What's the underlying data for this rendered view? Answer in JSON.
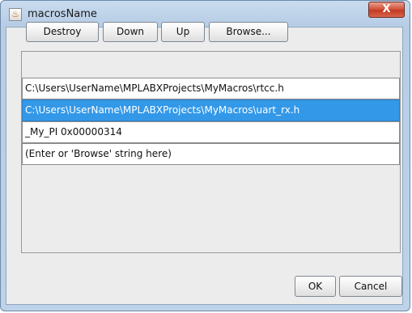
{
  "window": {
    "title": "macrosName",
    "app_icon_glyph": "♨",
    "close_glyph": "X"
  },
  "toolbar": {
    "destroy_label": "Destroy",
    "down_label": "Down",
    "up_label": "Up",
    "browse_label": "Browse..."
  },
  "list": {
    "items": [
      {
        "text": "C:\\Users\\UserName\\MPLABXProjects\\MyMacros\\rtcc.h",
        "selected": false
      },
      {
        "text": "C:\\Users\\UserName\\MPLABXProjects\\MyMacros\\uart_rx.h",
        "selected": true
      },
      {
        "text": "_My_PI 0x00000314",
        "selected": false
      },
      {
        "text": "(Enter or 'Browse' string here)",
        "selected": false
      }
    ]
  },
  "footer": {
    "ok_label": "OK",
    "cancel_label": "Cancel"
  },
  "colors": {
    "selection": "#3398e8",
    "title_bar": "#c9dbee",
    "close_button": "#c23a22"
  }
}
